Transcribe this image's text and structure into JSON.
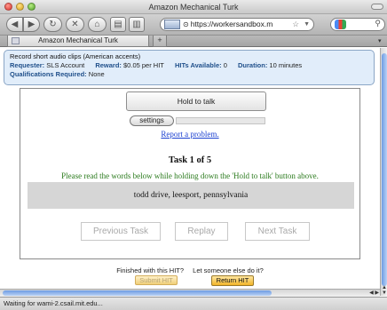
{
  "window": {
    "title": "Amazon Mechanical Turk"
  },
  "toolbar": {
    "url": "https://workersandbox.m",
    "back_icon": "back-arrow-icon",
    "forward_icon": "forward-arrow-icon"
  },
  "tabs": [
    {
      "label": "Amazon Mechanical Turk"
    }
  ],
  "new_tab_label": "+",
  "hit": {
    "title": "Record short audio clips (American accents)",
    "requester_label": "Requester:",
    "requester": "SLS Account",
    "reward_label": "Reward:",
    "reward": "$0.05 per HIT",
    "hits_available_label": "HITs Available:",
    "hits_available": "0",
    "duration_label": "Duration:",
    "duration": "10 minutes",
    "qualifications_label": "Qualifications Required:",
    "qualifications": "None"
  },
  "task": {
    "hold_button": "Hold to talk",
    "settings_button": "settings",
    "report_link": "Report a problem.",
    "title": "Task 1 of 5",
    "instructions": "Please read the words below while holding down the 'Hold to talk' button above.",
    "prompt": "todd drive, leesport, pennsylvania",
    "previous_button": "Previous Task",
    "replay_button": "Replay",
    "next_button": "Next Task"
  },
  "footer": {
    "finished_text": "Finished with this HIT?",
    "someone_else_text": "Let someone else do it?",
    "submit_button": "Submit HIT",
    "return_button": "Return HIT"
  },
  "status": {
    "text": "Waiting for wami-2.csail.mit.edu..."
  },
  "colors": {
    "hit_header_bg": "#e1edfa",
    "instructions_green": "#2a7a1c",
    "link_blue": "#1a3fd0",
    "return_button": "#f2b528"
  }
}
